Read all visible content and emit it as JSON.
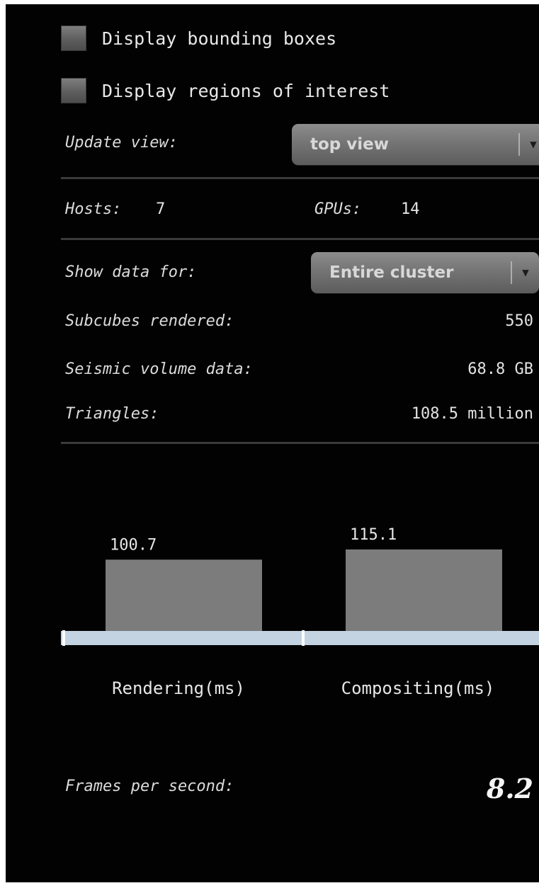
{
  "options": {
    "bounding_boxes_label": "Display bounding boxes",
    "regions_label": "Display regions of interest"
  },
  "view": {
    "label": "Update view:",
    "selected": "top view"
  },
  "cluster": {
    "hosts_label": "Hosts:",
    "hosts_value": "7",
    "gpus_label": "GPUs:",
    "gpus_value": "14"
  },
  "stats": {
    "show_label": "Show data for:",
    "show_selected": "Entire cluster",
    "subcubes_label": "Subcubes rendered:",
    "subcubes_value": "550",
    "seismic_label": "Seismic volume data:",
    "seismic_value": "68.8 GB",
    "triangles_label": "Triangles:",
    "triangles_value": "108.5 million"
  },
  "chart_data": {
    "type": "bar",
    "categories": [
      "Rendering(ms)",
      "Compositing(ms)"
    ],
    "values": [
      100.7,
      115.1
    ],
    "value_labels": [
      "100.7",
      "115.1"
    ],
    "title": "",
    "xlabel": "",
    "ylabel": "",
    "colors": {
      "bar": "#7c7c7c",
      "baseline": "#c4d3e1"
    }
  },
  "fps": {
    "label": "Frames per second:",
    "value": "8.2"
  },
  "icons": {
    "dropdown_arrow": "dropdown-arrow-icon"
  }
}
